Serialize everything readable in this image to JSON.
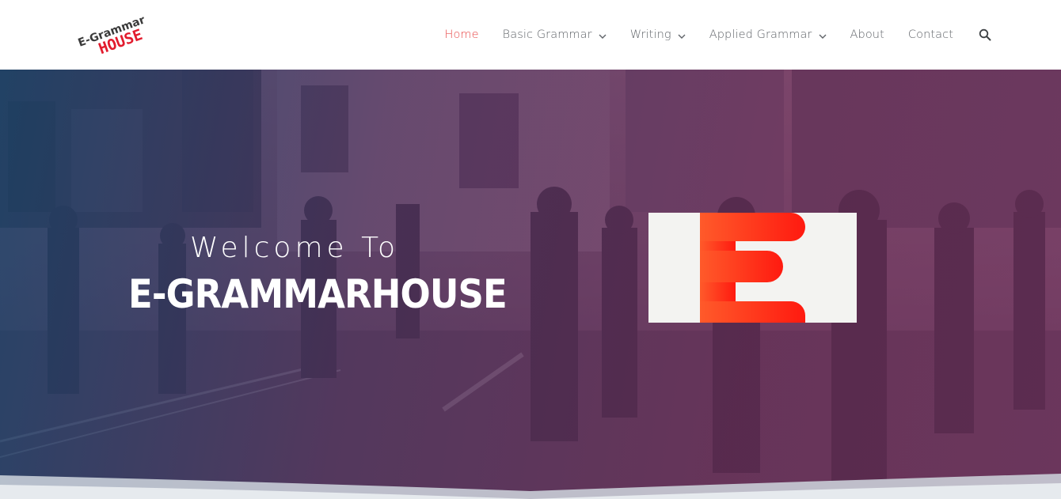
{
  "site": {
    "logo_text_top": "E-Grammar",
    "logo_text_bottom": "HOUSE"
  },
  "nav": {
    "items": [
      {
        "label": "Home",
        "active": true,
        "dropdown": false
      },
      {
        "label": "Basic Grammar",
        "active": false,
        "dropdown": true
      },
      {
        "label": "Writing",
        "active": false,
        "dropdown": true
      },
      {
        "label": "Applied Grammar",
        "active": false,
        "dropdown": true
      },
      {
        "label": "About",
        "active": false,
        "dropdown": false
      },
      {
        "label": "Contact",
        "active": false,
        "dropdown": false
      }
    ],
    "search_icon": "search-icon",
    "dropdown_icon": "chevron-down-icon"
  },
  "hero": {
    "welcome": "Welcome To",
    "title": "E-GRAMMARHOUSE",
    "card_letter": "E"
  },
  "colors": {
    "accent": "#e84a4a",
    "nav_text": "#5f6368",
    "logo_red": "#e21b2d",
    "card_red": "#ff2a1a",
    "overlay_blue": "#16486e",
    "overlay_purple": "#70345f"
  }
}
